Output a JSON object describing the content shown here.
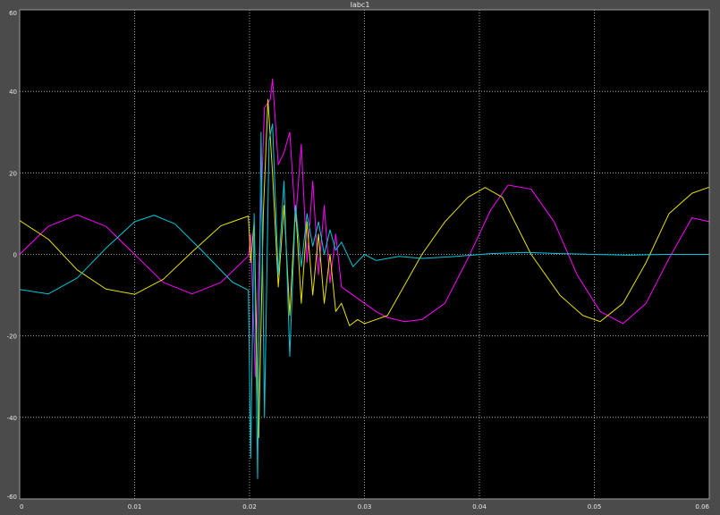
{
  "window": {
    "title": "Iabc1"
  },
  "colors": {
    "background": "#000000",
    "frame": "#4b4b4b",
    "grid": "#cfcfcf",
    "text": "#e8e8e8"
  },
  "chart_data": {
    "type": "line",
    "title": "Iabc1",
    "xlabel": "",
    "ylabel": "",
    "xlim": [
      0,
      0.06
    ],
    "ylim": [
      -60,
      60
    ],
    "xticks": [
      0,
      0.01,
      0.02,
      0.03,
      0.04,
      0.05,
      0.06
    ],
    "xtick_labels": [
      "0",
      "0.01",
      "0.02",
      "0.03",
      "0.04",
      "0.05",
      "0.06"
    ],
    "yticks": [
      -60,
      -40,
      -20,
      0,
      20,
      40,
      60
    ],
    "ytick_labels": [
      "-60",
      "-40",
      "-20",
      "0",
      "20",
      "40",
      "60"
    ],
    "grid": true,
    "series": [
      {
        "color": "#ff00ff",
        "x": [
          0,
          0.0025,
          0.005,
          0.0075,
          0.01,
          0.0125,
          0.015,
          0.0175,
          0.0199,
          0.0201,
          0.0205,
          0.021,
          0.0213,
          0.0218,
          0.022,
          0.0225,
          0.023,
          0.0235,
          0.024,
          0.0245,
          0.025,
          0.0255,
          0.026,
          0.0265,
          0.027,
          0.0275,
          0.028,
          0.029,
          0.03,
          0.031,
          0.032,
          0.0335,
          0.035,
          0.037,
          0.039,
          0.041,
          0.0425,
          0.0445,
          0.0465,
          0.0485,
          0.0505,
          0.0525,
          0.0545,
          0.0565,
          0.0585,
          0.06
        ],
        "y": [
          0,
          6.9,
          9.7,
          6.9,
          0,
          -6.9,
          -9.7,
          -6.9,
          -0.4,
          5,
          -30,
          12,
          36,
          38,
          43,
          22,
          25,
          30,
          8,
          27,
          -2,
          18,
          -5,
          12,
          -7,
          5,
          -8,
          -10,
          -12,
          -14,
          -15.5,
          -16.5,
          -16,
          -12,
          -1,
          11,
          17,
          16,
          8,
          -5,
          -14,
          -17,
          -12,
          -1,
          9,
          8
        ]
      },
      {
        "color": "#e8e000",
        "x": [
          0,
          0.0025,
          0.005,
          0.0075,
          0.01,
          0.0125,
          0.015,
          0.0175,
          0.0199,
          0.0201,
          0.0204,
          0.0208,
          0.0212,
          0.0216,
          0.022,
          0.0225,
          0.023,
          0.0235,
          0.024,
          0.0245,
          0.025,
          0.0255,
          0.026,
          0.0265,
          0.027,
          0.0275,
          0.028,
          0.0287,
          0.0294,
          0.03,
          0.031,
          0.032,
          0.033,
          0.035,
          0.037,
          0.039,
          0.0405,
          0.042,
          0.0445,
          0.047,
          0.049,
          0.0505,
          0.0525,
          0.0545,
          0.0565,
          0.0585,
          0.06
        ],
        "y": [
          8.3,
          3.7,
          -3.8,
          -8.5,
          -9.8,
          -6.1,
          0.6,
          7.0,
          9.4,
          -2,
          8,
          -45,
          10,
          38,
          20,
          -8,
          12,
          -15,
          12,
          -12,
          8,
          -10,
          5,
          -12,
          0,
          -14,
          -12,
          -17.5,
          -16,
          -17,
          -16,
          -15,
          -10,
          0,
          8,
          14,
          16.4,
          14,
          0,
          -10,
          -15,
          -16.5,
          -12,
          -2,
          10,
          15,
          16.5
        ]
      },
      {
        "color": "#00c8d8",
        "x": [
          0,
          0.0025,
          0.005,
          0.0075,
          0.01,
          0.0117,
          0.0135,
          0.016,
          0.0185,
          0.0199,
          0.0201,
          0.0204,
          0.0207,
          0.021,
          0.0213,
          0.0217,
          0.022,
          0.0225,
          0.023,
          0.0235,
          0.024,
          0.0245,
          0.025,
          0.0255,
          0.026,
          0.0265,
          0.027,
          0.0275,
          0.028,
          0.029,
          0.03,
          0.031,
          0.033,
          0.035,
          0.038,
          0.041,
          0.044,
          0.047,
          0.05,
          0.053,
          0.056,
          0.06
        ],
        "y": [
          -8.6,
          -9.7,
          -5.8,
          1.5,
          8.0,
          9.6,
          7.5,
          0.5,
          -6.8,
          -8.8,
          -50,
          10,
          -55,
          30,
          -40,
          28,
          32,
          -5,
          18,
          -25,
          12,
          -3,
          10,
          2,
          8,
          0,
          6,
          1,
          3,
          -3,
          0,
          -1.5,
          -0.5,
          -1,
          -0.5,
          0.2,
          0.5,
          0.2,
          0,
          -0.2,
          0,
          0
        ]
      }
    ]
  }
}
